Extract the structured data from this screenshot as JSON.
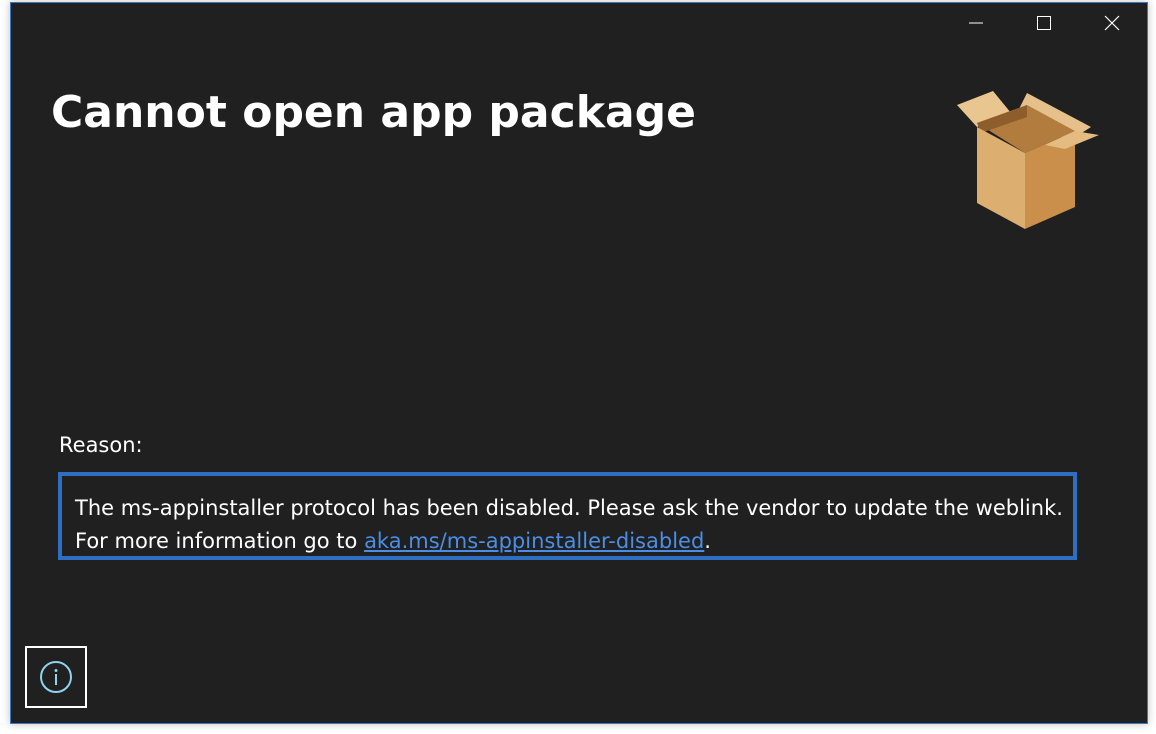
{
  "window": {
    "title": "Cannot open app package",
    "caption_buttons": {
      "minimize_icon": "minimize-icon",
      "maximize_icon": "maximize-icon",
      "close_icon": "close-icon"
    }
  },
  "header": {
    "icon": "package-box-icon"
  },
  "reason": {
    "label": "Reason:",
    "text_before": "The ms-appinstaller protocol has been disabled. Please ask the vendor to update the weblink. For more information go to ",
    "link_text": "aka.ms/ms-appinstaller-disabled",
    "text_after": "."
  },
  "footer": {
    "info_icon": "info-icon"
  },
  "colors": {
    "background": "#202020",
    "accent_border": "#2f6fc3",
    "link": "#4a8ee6",
    "box_light": "#e2b77a",
    "box_dark": "#c98f4b"
  }
}
